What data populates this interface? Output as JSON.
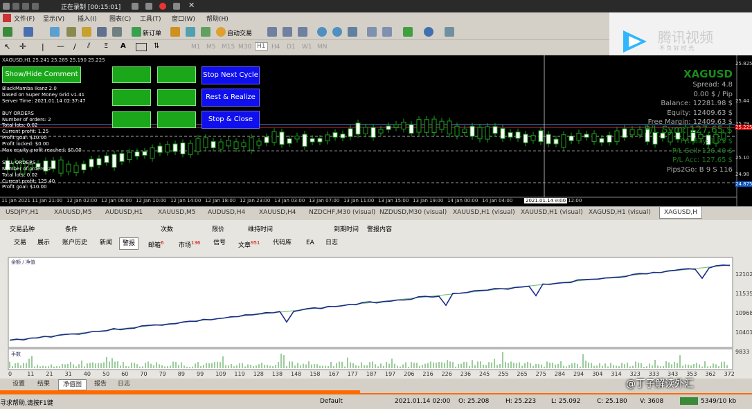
{
  "recorder": {
    "status": "正在录制 [00:15:01]"
  },
  "menu": [
    "文件(F)",
    "显示(V)",
    "插入(I)",
    "图表(C)",
    "工具(T)",
    "窗口(W)",
    "帮助(H)"
  ],
  "toolbar": {
    "new_order": "新订单",
    "auto_trade": "自动交易",
    "timeframes": [
      "M1",
      "M5",
      "M15",
      "M30",
      "H1",
      "H4",
      "D1",
      "W1",
      "MN"
    ]
  },
  "watermark": {
    "brand": "腾讯视频",
    "slogan": "不 负 好 时 光"
  },
  "chart": {
    "header": "XAGUSD,H1  25.241 25.285 25.190 25.225",
    "buttons": {
      "show_hide": "Show/Hide Comment",
      "stop_next": "Stop Next Cycle",
      "rest_realize": "Rest & Realize",
      "stop_close": "Stop & Close"
    },
    "ea_info": [
      "BlackMamba Ikanz 2.0",
      "based on Super Money Grid v1.41",
      "Server Time: 2021.01.14 02:37:47",
      "",
      "BUY ORDERS",
      "Number of orders: 2",
      "Total lots: 0.02",
      "Current profit: 1.25",
      "Profit goal: $10.00",
      "Profit locked: $0.00",
      "Max equity profit reached: $0.00",
      "",
      "SELL ORDERS",
      "Number of orders: 2",
      "Total lots: 0.02",
      "Current profit: 125.40",
      "Profit goal: $10.00"
    ],
    "symbol": "XAGUSD",
    "right_info": [
      "Spread: 4.8",
      "0.00 $ / Pip",
      "Balance: 12281.98 $",
      "Equity: 12409.63 $",
      "Free Margin: 12409.63 $"
    ],
    "pl_sym": "P/L Sym: 127.65 $",
    "right_info2": [
      "P/L Buy: 1.25 $",
      "P/L Sell: 126.40 $",
      "P/L Acc: 127.65 $",
      "Pips2Go: B 9 S 116"
    ],
    "price_labels": [
      "25.825",
      "25.44",
      "25.29",
      "25.225",
      "25.10",
      "24.98",
      "24.875"
    ],
    "time_labels": [
      "11 Jan 2021",
      "11 Jan 21:00",
      "12 Jan 02:00",
      "12 Jan 06:00",
      "12 Jan 10:00",
      "12 Jan 14:00",
      "12 Jan 18:00",
      "12 Jan 23:00",
      "13 Jan 03:00",
      "13 Jan 07:00",
      "13 Jan 11:00",
      "13 Jan 15:00",
      "13 Jan 19:00",
      "14 Jan 00:00",
      "14 Jan 04:00",
      "2021.01.14 9:00",
      "14 Jan 12:00"
    ]
  },
  "symbol_tabs": [
    "USDJPY,H1",
    "XAUUSD,M5",
    "AUDUSD,H1",
    "XAUUSD,M5",
    "AUDUSD,H4",
    "XAUUSD,H4",
    "NZDCHF,M30 (visual)",
    "NZDUSD,M30 (visual)",
    "XAUUSD,H1 (visual)",
    "XAUUSD,H1 (visual)",
    "XAGUSD,H1 (visual)",
    "XAGUSD,H"
  ],
  "terminal_headers": [
    "交易品种",
    "条件",
    "次数",
    "限价",
    "维持时间",
    "到期时间",
    "警报内容"
  ],
  "terminal_tabs": [
    {
      "label": "交易"
    },
    {
      "label": "展示"
    },
    {
      "label": "账户历史"
    },
    {
      "label": "新闻"
    },
    {
      "label": "警报"
    },
    {
      "label": "邮箱",
      "badge": "6"
    },
    {
      "label": "市场",
      "badge": "136"
    },
    {
      "label": "信号"
    },
    {
      "label": "文章",
      "badge": "951"
    },
    {
      "label": "代码库"
    },
    {
      "label": "EA"
    },
    {
      "label": "日志"
    }
  ],
  "graph": {
    "legend": "余额 / 净值",
    "y_labels": [
      "12102",
      "11535",
      "10968",
      "10401",
      "9833"
    ],
    "volume_label": "手数",
    "x_labels": [
      "0",
      "11",
      "21",
      "31",
      "40",
      "50",
      "60",
      "70",
      "79",
      "89",
      "99",
      "109",
      "119",
      "128",
      "138",
      "148",
      "158",
      "167",
      "177",
      "187",
      "197",
      "206",
      "216",
      "226",
      "236",
      "245",
      "255",
      "265",
      "275",
      "284",
      "294",
      "304",
      "314",
      "323",
      "333",
      "343",
      "353",
      "362",
      "372"
    ]
  },
  "bottom_tabs": [
    "设置",
    "结果",
    "净值图",
    "报告",
    "日志"
  ],
  "social": "@丁子解读外汇",
  "status": {
    "help": "寻求帮助,请按F1键",
    "profile": "Default",
    "datetime": "2021.01.14 02:00",
    "open": "O: 25.208",
    "high": "H: 25.223",
    "low": "L: 25.092",
    "close": "C: 25.180",
    "volume": "V: 3608",
    "traffic": "5349/10 kb"
  }
}
